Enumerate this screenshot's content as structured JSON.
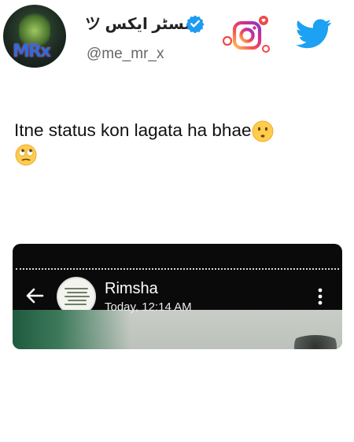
{
  "header": {
    "display_name": "مسٹر ایکس ツ",
    "handle": "@me_mr_x",
    "avatar_icon": "profile-avatar-icon",
    "verified_icon": "verified-badge-icon",
    "instagram_icon": "instagram-logo-icon",
    "twitter_icon": "twitter-bird-icon"
  },
  "tweet": {
    "text": "Itne status kon lagata ha bhae",
    "emojis": [
      "hushed-face-emoji",
      "eye-roll-emoji"
    ]
  },
  "status_card": {
    "contact_name": "Rimsha",
    "timestamp": "Today, 12:14 AM",
    "back_icon": "back-arrow-icon",
    "menu_icon": "more-vert-icon"
  },
  "colors": {
    "twitter_blue": "#1da1f2",
    "verified_blue": "#1d9bf0",
    "card_bg": "#0a0a0a"
  }
}
